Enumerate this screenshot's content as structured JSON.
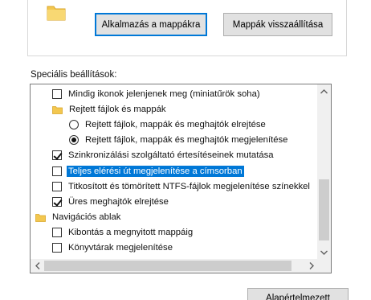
{
  "buttons": {
    "apply_to_folders": "Alkalmazás a mappákra",
    "reset_folders": "Mappák visszaállítása",
    "restore_defaults": "Alapértelmezett"
  },
  "advanced": {
    "label": "Speciális beállítások:",
    "items": [
      {
        "type": "checkbox",
        "checked": false,
        "label": "Mindig ikonok jelenjenek meg (miniatűrök soha)"
      },
      {
        "type": "folder",
        "label": "Rejtett fájlok és mappák"
      },
      {
        "type": "radio",
        "checked": false,
        "label": "Rejtett fájlok, mappák és meghajtók elrejtése"
      },
      {
        "type": "radio",
        "checked": true,
        "label": "Rejtett fájlok, mappák és meghajtók megjelenítése"
      },
      {
        "type": "checkbox",
        "checked": true,
        "label": "Szinkronizálási szolgáltató értesítéseinek mutatása"
      },
      {
        "type": "checkbox",
        "checked": false,
        "selected": true,
        "label": "Teljes elérési út megjelenítése a címsorban"
      },
      {
        "type": "checkbox",
        "checked": false,
        "label": "Titkosított és tömörített NTFS-fájlok megjelenítése színekkel"
      },
      {
        "type": "checkbox",
        "checked": true,
        "label": "Üres meghajtók elrejtése"
      },
      {
        "type": "folder-nav",
        "label": "Navigációs ablak"
      },
      {
        "type": "checkbox",
        "checked": false,
        "label": "Kibontás a megnyitott mappáig"
      },
      {
        "type": "checkbox",
        "checked": false,
        "label": "Könyvtárak megjelenítése"
      }
    ]
  },
  "icons": {
    "folder": "folder-icon",
    "scroll_up": "chevron-up-icon",
    "scroll_down": "chevron-down-icon",
    "scroll_left": "chevron-left-icon",
    "scroll_right": "chevron-right-icon"
  },
  "colors": {
    "selection": "#0078d7",
    "folder": "#f3c74f",
    "button_face": "#e1e1e1"
  }
}
